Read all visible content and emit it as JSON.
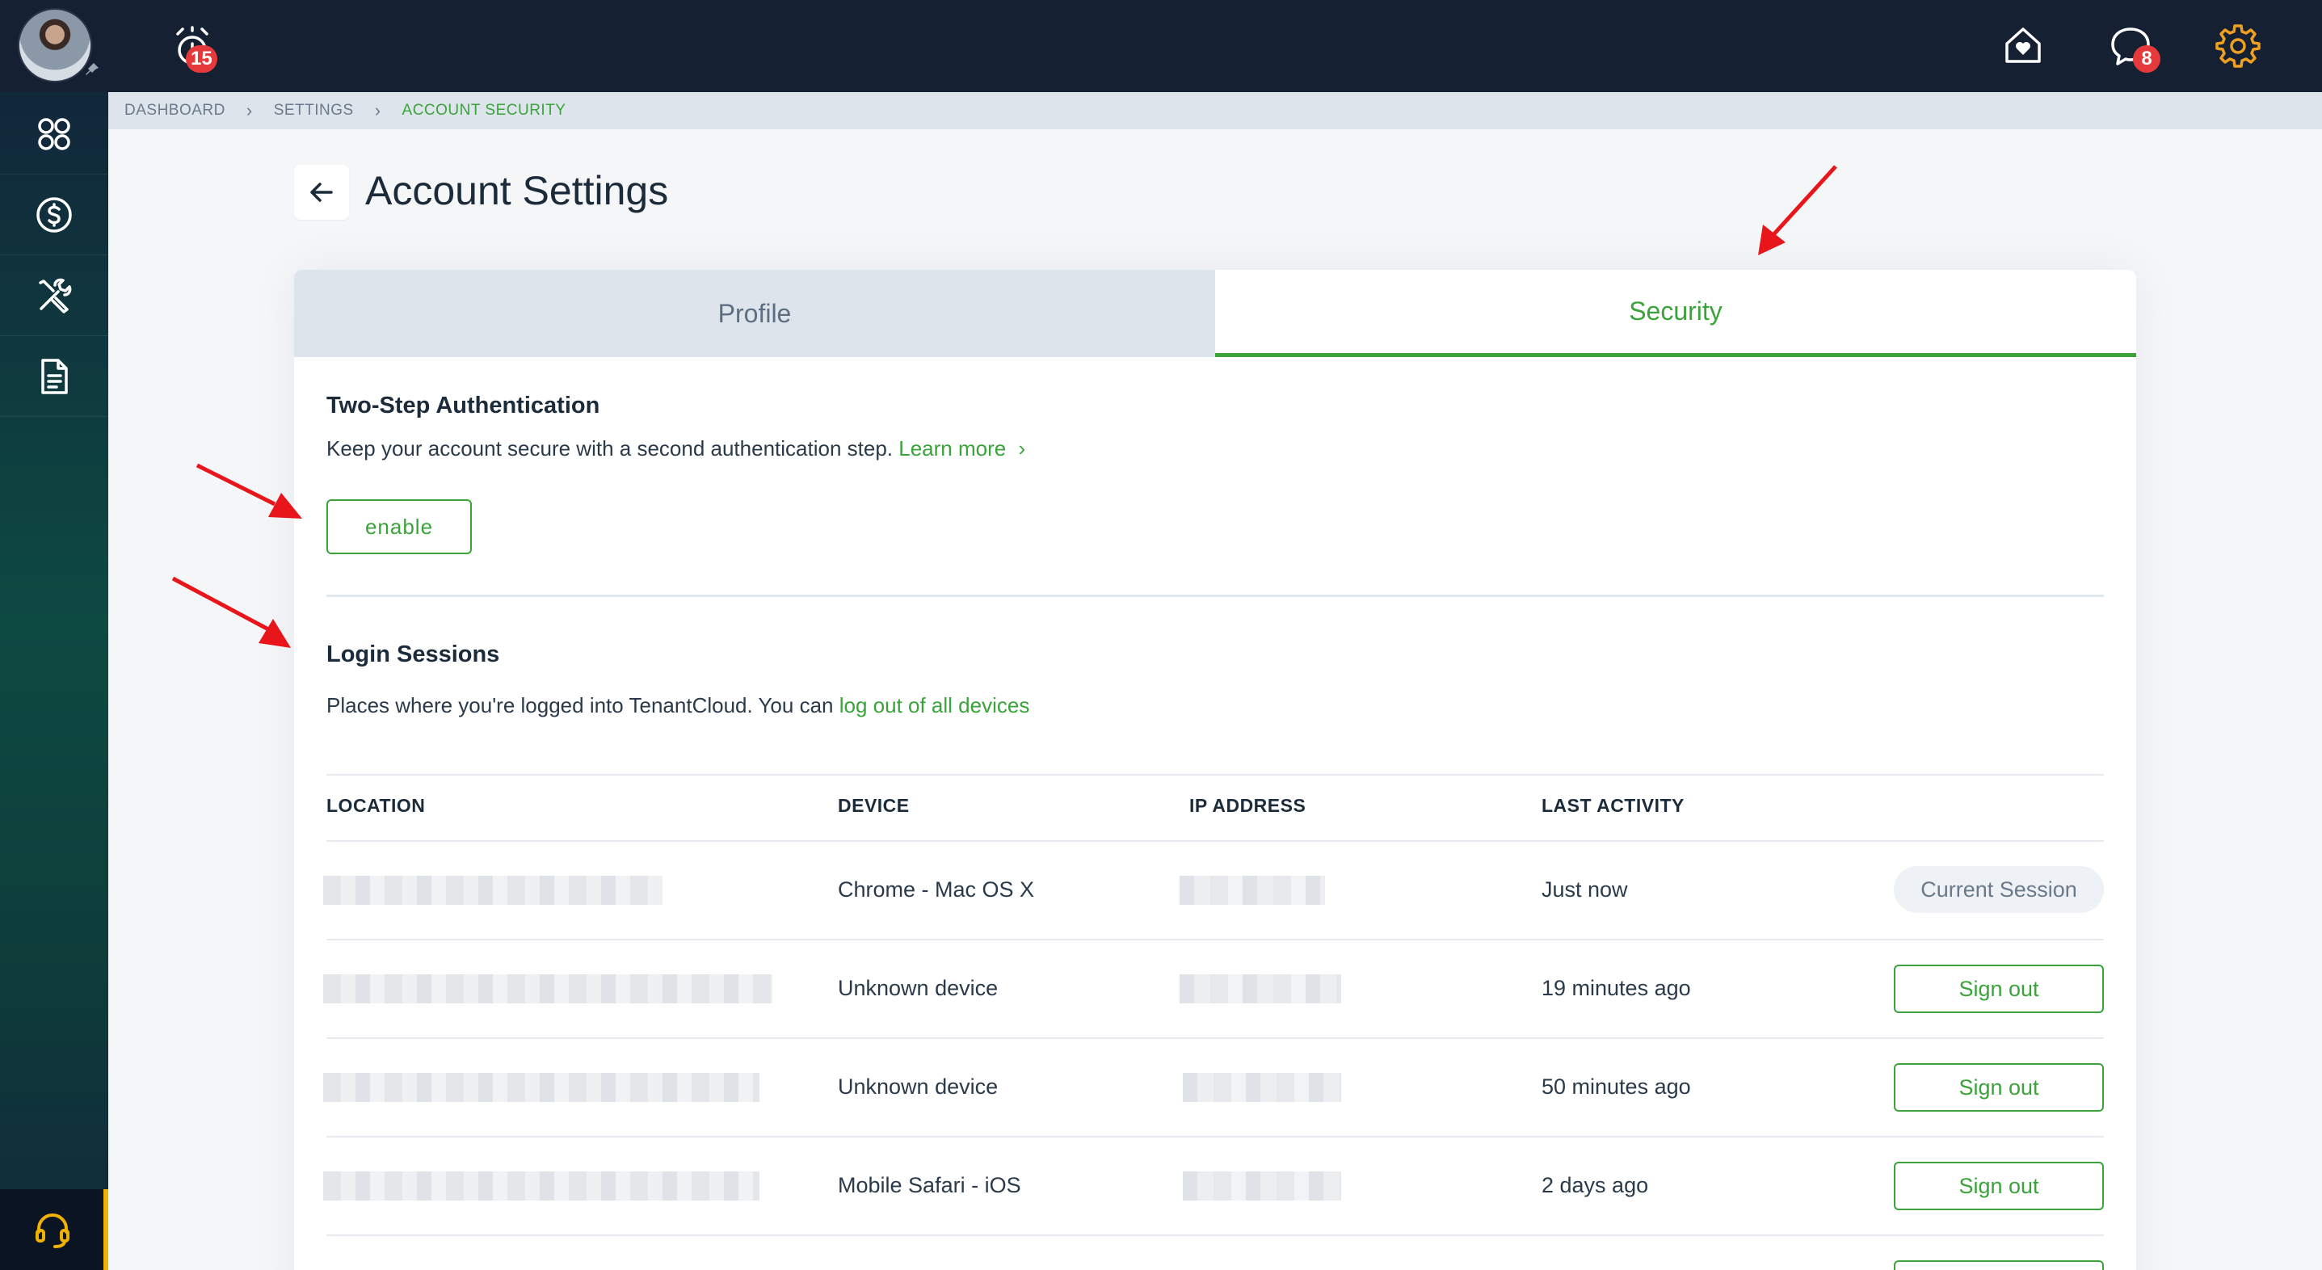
{
  "topbar": {
    "alarm_count": "15",
    "chat_count": "8"
  },
  "breadcrumb": {
    "items": [
      "DASHBOARD",
      "SETTINGS",
      "ACCOUNT SECURITY"
    ],
    "separator": "›"
  },
  "page": {
    "title": "Account Settings"
  },
  "tabs": [
    {
      "label": "Profile",
      "active": false
    },
    {
      "label": "Security",
      "active": true
    }
  ],
  "two_step": {
    "title": "Two-Step Authentication",
    "description": "Keep your account secure with a second authentication step.",
    "learn_more": "Learn more",
    "learn_more_chevron": "›",
    "button": "enable"
  },
  "sessions": {
    "title": "Login Sessions",
    "description": "Places where you're logged into TenantCloud. You can",
    "logout_link": "log out of all devices",
    "columns": [
      "LOCATION",
      "DEVICE",
      "IP ADDRESS",
      "LAST ACTIVITY"
    ],
    "rows": [
      {
        "device": "Chrome - Mac OS X",
        "last_activity": "Just now",
        "action": "Current Session"
      },
      {
        "device": "Unknown device",
        "last_activity": "19 minutes ago",
        "action": "Sign out"
      },
      {
        "device": "Unknown device",
        "last_activity": "50 minutes ago",
        "action": "Sign out"
      },
      {
        "device": "Mobile Safari - iOS",
        "last_activity": "2 days ago",
        "action": "Sign out"
      }
    ]
  },
  "colors": {
    "accent": "#3aa33a",
    "topbar": "#162033",
    "badge": "#e5393b",
    "gear": "#f0a020",
    "annotation_arrow": "#e8161b"
  },
  "icons": [
    "alarm-icon",
    "home-heart-icon",
    "chat-icon",
    "gear-icon",
    "dashboard-grid-icon",
    "dollar-icon",
    "tools-icon",
    "document-icon",
    "headset-icon",
    "back-arrow-icon"
  ]
}
